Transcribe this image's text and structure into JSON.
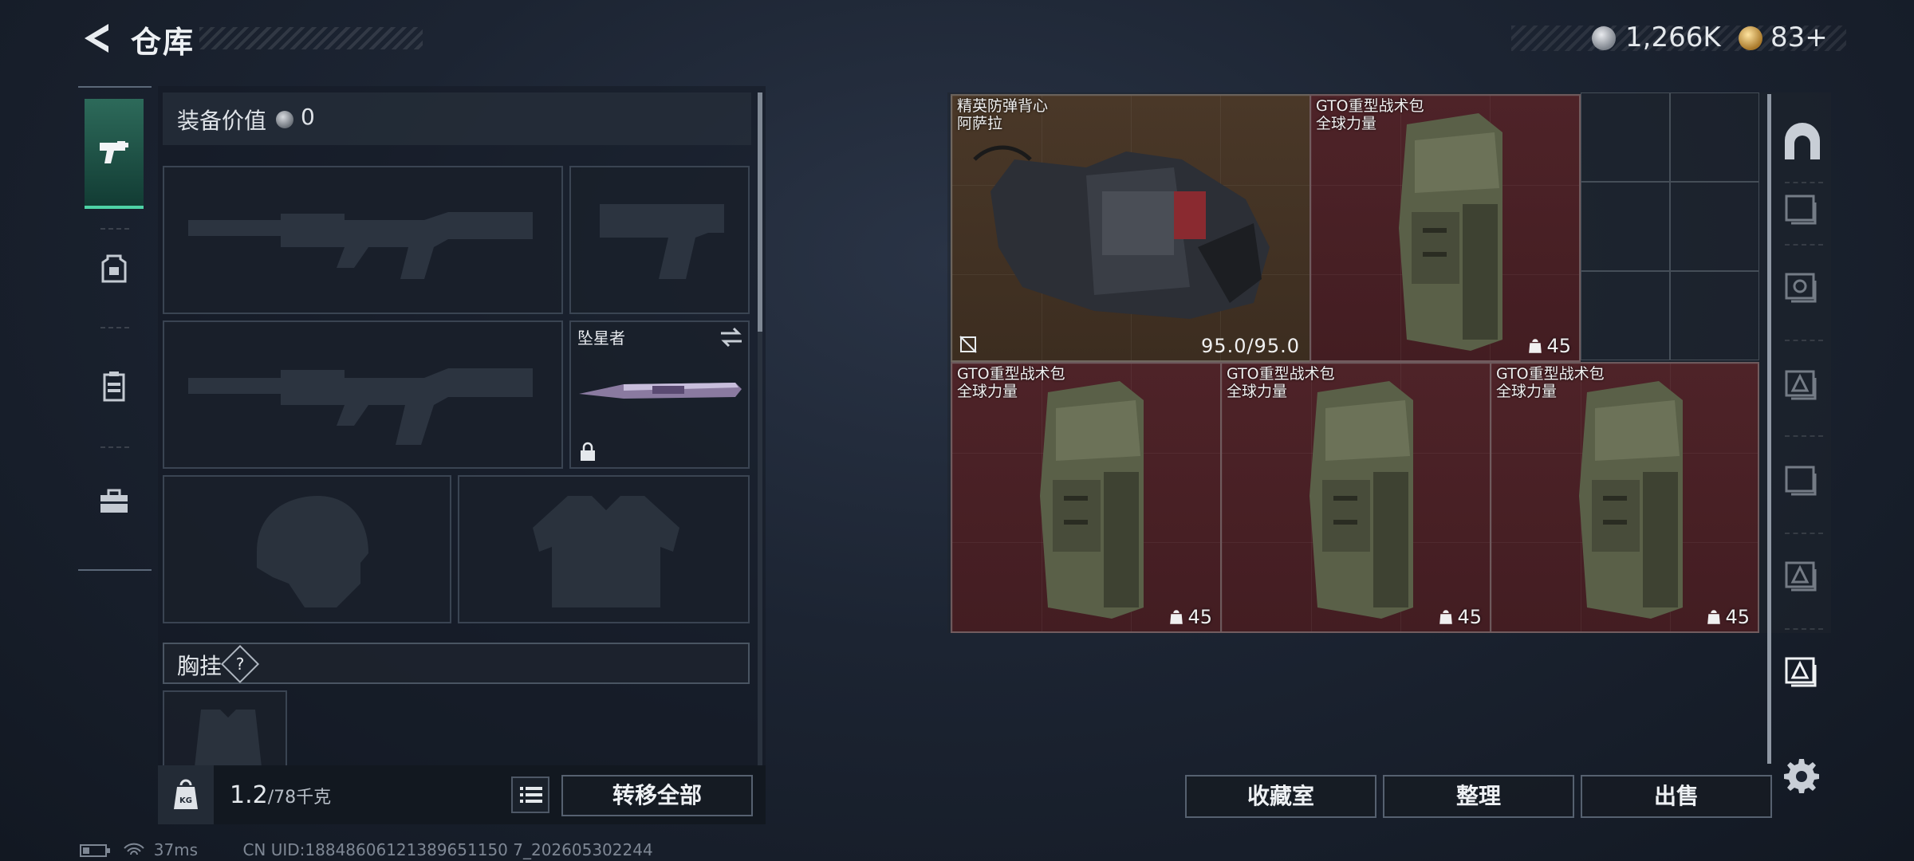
{
  "header": {
    "title": "仓库",
    "currency_silver": "1,266K",
    "currency_gold": "83+"
  },
  "equipment": {
    "value_label": "装备价值",
    "value": "0",
    "melee_name": "坠星者",
    "chest_label": "胸挂",
    "chest_help": "?"
  },
  "capacity": {
    "current": "1.2",
    "max": "/78千克",
    "weight_icon_label": "KG"
  },
  "buttons": {
    "transfer_all": "转移全部",
    "collection": "收藏室",
    "organize": "整理",
    "sell": "出售"
  },
  "stash_items": [
    {
      "name": "精英防弹背心",
      "sub": "阿萨拉",
      "stat": "95.0/95.0"
    },
    {
      "name": "GTO重型战术包",
      "sub": "全球力量",
      "stat": "45"
    },
    {
      "name": "GTO重型战术包",
      "sub": "全球力量",
      "stat": "45"
    },
    {
      "name": "GTO重型战术包",
      "sub": "全球力量",
      "stat": "45"
    },
    {
      "name": "GTO重型战术包",
      "sub": "全球力量",
      "stat": "45"
    }
  ],
  "status_bar": {
    "ping": "37ms",
    "uid": "CN UID:18848606121389651150 7_202605302244"
  },
  "colors": {
    "accent": "#4ed2a6",
    "item_red": "#4e2328",
    "item_brown": "#4a3828"
  },
  "icons": [
    "back-arrow-icon",
    "silver-coin-icon",
    "gold-coin-icon",
    "pistol-icon",
    "backpack-icon",
    "chest-rig-icon",
    "toolbox-icon",
    "lock-icon",
    "swap-icon",
    "list-icon",
    "weight-icon",
    "gear-icon",
    "bunker-icon",
    "battery-icon",
    "wifi-icon"
  ]
}
